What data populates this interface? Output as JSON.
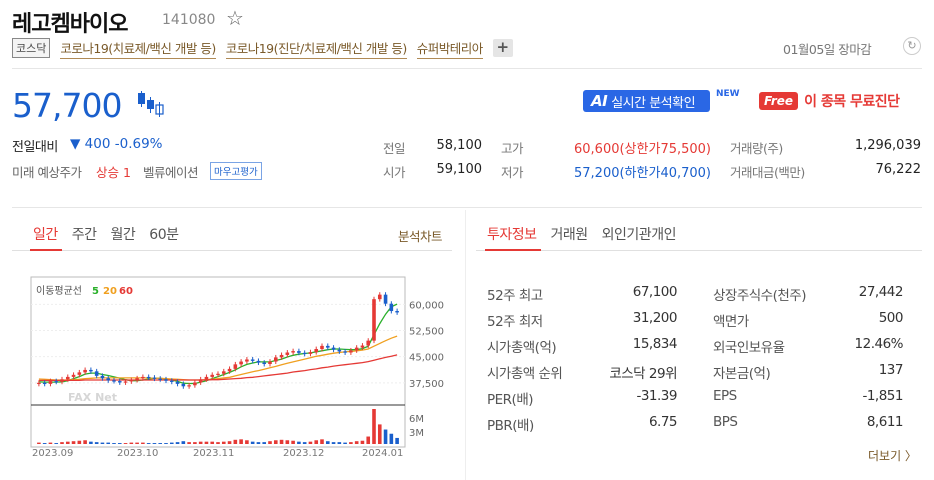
{
  "stock": {
    "name": "레고켐바이오",
    "code": "141080",
    "market_tag": "코스닥",
    "themes": [
      "코로나19(치료제/백신 개발 등)",
      "코로나19(진단/치료제/백신 개발 등)",
      "슈퍼박테리아"
    ],
    "date": "01월05일 장마감",
    "price": "57,700",
    "change_label": "전일대비",
    "change_value": "▼ 400 -0.69%",
    "pred_label": "미래 예상주가",
    "pred_value": "상승 1",
    "valuation_label": "벨류에이션",
    "valuation_button": "마우고평가"
  },
  "promo": {
    "ai_prefix": "AI",
    "ai_label": "실시간 분석확인",
    "new_badge": "NEW",
    "free_badge": "Free",
    "free_text": "이 종목 무료진단"
  },
  "quote": {
    "prev_label": "전일",
    "prev_value": "58,100",
    "open_label": "시가",
    "open_value": "59,100",
    "high_label": "고가",
    "high_value": "60,600(상한가75,500)",
    "low_label": "저가",
    "low_value": "57,200(하한가40,700)",
    "vol_label": "거래량(주)",
    "vol_value": "1,296,039",
    "amt_label": "거래대금(백만)",
    "amt_value": "76,222"
  },
  "chart_tabs": {
    "items": [
      "일간",
      "주간",
      "월간",
      "60분"
    ],
    "active": "일간",
    "analysis": "분석차트"
  },
  "chart_data": {
    "type": "line",
    "legend_title": "이동평균선",
    "ma_labels": [
      "5",
      "20",
      "60"
    ],
    "ma_colors": [
      "#2bb02b",
      "#f0a020",
      "#e53935"
    ],
    "y_ticks": [
      "60,000",
      "52,500",
      "45,000",
      "37,500"
    ],
    "y_tick_values": [
      60000,
      52500,
      45000,
      37500
    ],
    "volume_ticks": [
      "6M",
      "3M"
    ],
    "x_labels": [
      "2023.09",
      "2023.10",
      "2023.11",
      "2023.12",
      "2024.01"
    ],
    "watermark": "FAX Net",
    "ylim": [
      32000,
      67000
    ],
    "closes": [
      37500,
      37200,
      38000,
      37800,
      38500,
      39200,
      39800,
      40500,
      41200,
      40800,
      39500,
      38800,
      38200,
      38000,
      37600,
      37900,
      38300,
      38800,
      39200,
      39000,
      38700,
      38500,
      38100,
      37800,
      37200,
      36500,
      36800,
      37600,
      38500,
      39200,
      39800,
      40100,
      40800,
      41500,
      42800,
      43600,
      44200,
      43800,
      43300,
      42900,
      43600,
      44800,
      45500,
      46200,
      46600,
      46100,
      45800,
      46300,
      47200,
      48100,
      47600,
      47000,
      46500,
      46200,
      46800,
      47600,
      48200,
      49600,
      61500,
      62800,
      60200,
      58100,
      57700
    ],
    "ma5": [
      37800,
      37700,
      37700,
      37700,
      37800,
      38100,
      38700,
      39300,
      40000,
      40300,
      40300,
      39900,
      39600,
      39200,
      38800,
      38400,
      38100,
      38100,
      38300,
      38600,
      38800,
      38800,
      38600,
      38300,
      37900,
      37400,
      37300,
      37300,
      37700,
      38100,
      38700,
      39300,
      39900,
      40500,
      41200,
      42100,
      42800,
      43200,
      43500,
      43500,
      43500,
      43900,
      44300,
      44900,
      45400,
      45700,
      45900,
      46100,
      46400,
      46700,
      47000,
      47200,
      47200,
      47100,
      47000,
      47000,
      47300,
      48000,
      51300,
      54500,
      57200,
      59300,
      60100
    ],
    "ma20": [
      38600,
      38500,
      38400,
      38300,
      38300,
      38300,
      38400,
      38500,
      38700,
      38800,
      38900,
      38900,
      38900,
      38900,
      38900,
      38900,
      38900,
      38900,
      38900,
      38900,
      38800,
      38800,
      38700,
      38600,
      38500,
      38400,
      38300,
      38300,
      38300,
      38400,
      38500,
      38700,
      38900,
      39100,
      39500,
      39900,
      40300,
      40700,
      41000,
      41400,
      41800,
      42200,
      42700,
      43100,
      43500,
      43900,
      44300,
      44700,
      45100,
      45400,
      45700,
      46000,
      46200,
      46400,
      46500,
      46700,
      46900,
      47200,
      48000,
      48800,
      49600,
      50300,
      50900
    ],
    "ma60": [
      38200,
      38200,
      38200,
      38200,
      38200,
      38200,
      38200,
      38200,
      38300,
      38300,
      38300,
      38300,
      38300,
      38300,
      38300,
      38300,
      38300,
      38300,
      38300,
      38300,
      38300,
      38300,
      38300,
      38300,
      38300,
      38300,
      38300,
      38300,
      38300,
      38300,
      38400,
      38400,
      38500,
      38600,
      38700,
      38800,
      39000,
      39100,
      39300,
      39500,
      39700,
      39900,
      40100,
      40300,
      40600,
      40800,
      41000,
      41300,
      41500,
      41800,
      42000,
      42300,
      42500,
      42700,
      42900,
      43100,
      43300,
      43600,
      44000,
      44400,
      44800,
      45100,
      45500
    ],
    "volumes": [
      0.3,
      0.2,
      0.3,
      0.2,
      0.4,
      0.5,
      0.6,
      0.7,
      0.8,
      0.5,
      0.4,
      0.3,
      0.3,
      0.2,
      0.2,
      0.2,
      0.3,
      0.3,
      0.3,
      0.2,
      0.2,
      0.2,
      0.2,
      0.3,
      0.4,
      0.6,
      0.4,
      0.4,
      0.5,
      0.5,
      0.5,
      0.4,
      0.5,
      0.6,
      0.9,
      1.0,
      0.8,
      0.5,
      0.4,
      0.4,
      0.6,
      0.8,
      0.9,
      0.8,
      0.7,
      0.5,
      0.4,
      0.5,
      0.8,
      1.0,
      0.6,
      0.4,
      0.4,
      0.3,
      0.4,
      0.6,
      0.7,
      1.6,
      7.5,
      4.2,
      3.1,
      2.2,
      1.3
    ]
  },
  "invest_tabs": {
    "items": [
      "투자정보",
      "거래원",
      "외인기관개인"
    ],
    "active": "투자정보"
  },
  "invest": {
    "left": [
      {
        "label": "52주 최고",
        "value": "67,100"
      },
      {
        "label": "52주 최저",
        "value": "31,200"
      },
      {
        "label": "시가총액(억)",
        "value": "15,834"
      },
      {
        "label": "시가총액 순위",
        "value": "코스닥 29위"
      },
      {
        "label": "PER(배)",
        "value": "-31.39"
      },
      {
        "label": "PBR(배)",
        "value": "6.75"
      }
    ],
    "right": [
      {
        "label": "상장주식수(천주)",
        "value": "27,442"
      },
      {
        "label": "액면가",
        "value": "500"
      },
      {
        "label": "외국인보유율",
        "value": "12.46%"
      },
      {
        "label": "자본금(억)",
        "value": "137"
      },
      {
        "label": "EPS",
        "value": "-1,851"
      },
      {
        "label": "BPS",
        "value": "8,611"
      }
    ],
    "more": "더보기 〉"
  }
}
